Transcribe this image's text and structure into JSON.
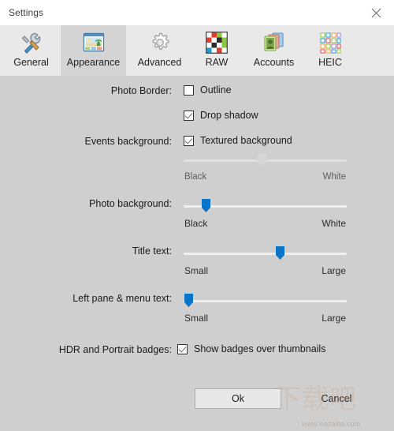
{
  "window": {
    "title": "Settings",
    "close_icon": "close-icon"
  },
  "tabs": [
    {
      "label": "General",
      "icon": "hammer-wrench-icon",
      "selected": false
    },
    {
      "label": "Appearance",
      "icon": "photo-window-icon",
      "selected": true
    },
    {
      "label": "Advanced",
      "icon": "gear-icon",
      "selected": false
    },
    {
      "label": "RAW",
      "icon": "color-grid-icon",
      "selected": false
    },
    {
      "label": "Accounts",
      "icon": "person-cards-icon",
      "selected": false
    },
    {
      "label": "HEIC",
      "icon": "dot-grid-icon",
      "selected": false
    }
  ],
  "settings": {
    "photo_border": {
      "label": "Photo Border:",
      "options": [
        {
          "label": "Outline",
          "checked": false
        },
        {
          "label": "Drop shadow",
          "checked": true
        }
      ]
    },
    "events_background": {
      "label": "Events background:",
      "checkbox": {
        "label": "Textured background",
        "checked": true
      },
      "slider": {
        "low_label": "Black",
        "high_label": "White",
        "value_percent": 50,
        "enabled": false
      }
    },
    "photo_background": {
      "label": "Photo background:",
      "slider": {
        "low_label": "Black",
        "high_label": "White",
        "value_percent": 14,
        "enabled": true
      }
    },
    "title_text": {
      "label": "Title text:",
      "slider": {
        "low_label": "Small",
        "high_label": "Large",
        "value_percent": 59,
        "enabled": true
      }
    },
    "left_pane_menu_text": {
      "label": "Left pane & menu text:",
      "slider": {
        "low_label": "Small",
        "high_label": "Large",
        "value_percent": 4,
        "enabled": true
      }
    },
    "hdr_portrait_badges": {
      "label": "HDR and Portrait badges:",
      "checkbox": {
        "label": "Show badges over thumbnails",
        "checked": true
      }
    }
  },
  "footer": {
    "ok_label": "Ok",
    "cancel_label": "Cancel"
  },
  "watermark": {
    "mark": "下载吧",
    "url": "www.xiazaiba.com"
  },
  "colors": {
    "window_bg": "#cfcfcf",
    "tabstrip_bg": "#e9e9e9",
    "tab_selected_bg": "#d4d4d4",
    "titlebar_bg": "#ffffff",
    "slider_thumb": "#0a74c8",
    "slider_track": "#efefef",
    "button_face": "#e8e8e8",
    "text": "#1a1a1a"
  }
}
